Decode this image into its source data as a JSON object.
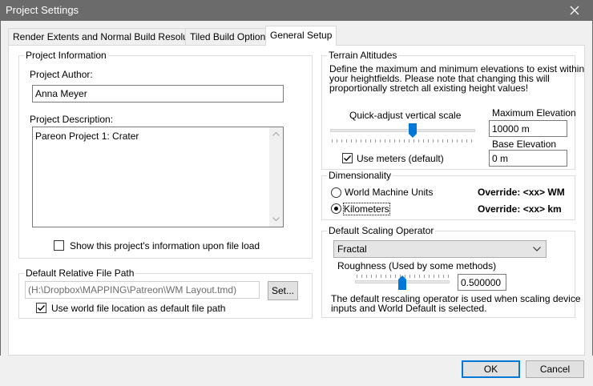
{
  "window": {
    "title": "Project Settings",
    "close_glyph": "close-icon"
  },
  "tabs": [
    {
      "label": "Render Extents and Normal Build Resolution",
      "active": false
    },
    {
      "label": "Tiled Build Options",
      "active": false
    },
    {
      "label": "General Setup",
      "active": true
    }
  ],
  "project_info": {
    "group_label": "Project Information",
    "author_label": "Project Author:",
    "author_value": "Anna Meyer",
    "description_label": "Project Description:",
    "description_value": "Pareon Project 1: Crater",
    "show_info_label": "Show this project's information upon file load",
    "show_info_checked": false
  },
  "file_path": {
    "group_label": "Default Relative File Path",
    "path_value": "(H:\\Dropbox\\MAPPING\\Patreon\\WM Layout.tmd)",
    "set_button": "Set...",
    "world_location_label": "Use world file location as default file path",
    "world_location_checked": true
  },
  "terrain": {
    "group_label": "Terrain Altitudes",
    "description": [
      "Define the maximum and minimum elevations to exist within",
      "your heightfields. Please note that changing this will",
      "proportionally stretch all existing height values!"
    ],
    "quick_adjust_label": "Quick-adjust vertical scale",
    "quick_adjust_level": 0.57,
    "use_meters_label": "Use meters (default)",
    "use_meters_checked": true,
    "max_label": "Maximum Elevation",
    "max_value": "10000 m",
    "base_label": "Base Elevation",
    "base_value": "0 m"
  },
  "dimensionality": {
    "group_label": "Dimensionality",
    "options": [
      {
        "label": "World Machine Units",
        "override": "Override: <xx> WM",
        "selected": false
      },
      {
        "label": "Kilometers",
        "override": "Override: <xx> km",
        "selected": true
      }
    ]
  },
  "scaling": {
    "group_label": "Default Scaling Operator",
    "selected_operator": "Fractal",
    "roughness_label": "Roughness (Used by some methods)",
    "roughness_value": "0.500000",
    "roughness_level": 0.5,
    "note": [
      "The default rescaling operator is used when scaling device",
      "inputs and World Default is selected."
    ]
  },
  "buttons": {
    "ok": "OK",
    "cancel": "Cancel"
  },
  "colors": {
    "titlebar": "#6b6b6b",
    "accent": "#0078d7"
  }
}
